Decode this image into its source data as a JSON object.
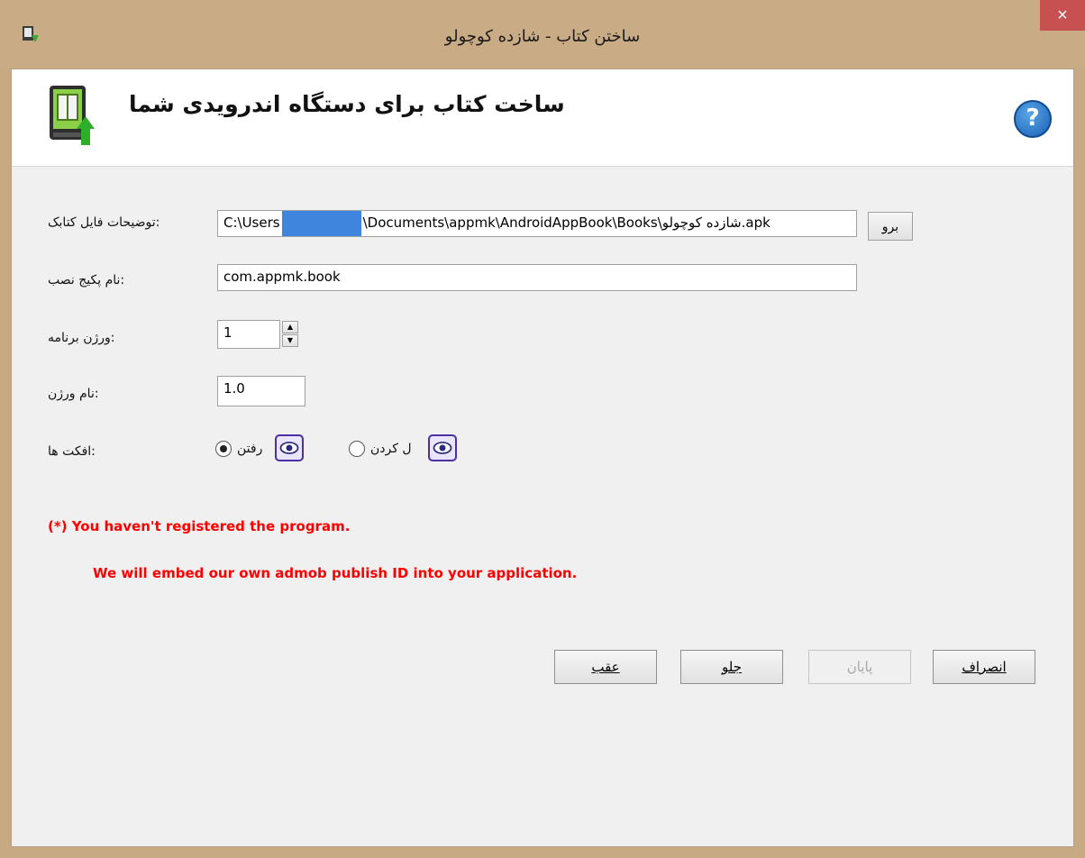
{
  "window": {
    "title": "ساختن کتاب - شازده کوچولو",
    "close_label": "×"
  },
  "header": {
    "title": "ساخت کتاب برای دستگاه اندرویدی شما",
    "help_label": "?"
  },
  "form": {
    "file_label": ":توضیحات فایل کتابک",
    "file_path_prefix": "C:\\Users",
    "file_path_suffix": "\\Documents\\appmk\\AndroidAppBook\\Books\\شازده کوچولو.apk",
    "browse_label": "برو",
    "package_label": ":نام پکیج نصب",
    "package_value": "com.appmk.book",
    "version_label": ":ورژن برنامه",
    "version_value": "1",
    "version_name_label": ":نام ورژن",
    "version_name_value": "1.0",
    "effects_label": ":افکت ها",
    "effect_1_label": "رفتن",
    "effect_1_checked": true,
    "effect_2_label": "ل کردن",
    "effect_2_checked": false
  },
  "warnings": {
    "line1": "(*)   You haven't registered the program.",
    "line2": "We will embed our own admob publish ID into your  application."
  },
  "buttons": {
    "back": "عقب",
    "next": "جلو",
    "finish": "پایان",
    "cancel": "انصراف"
  },
  "colors": {
    "title_bar": "#c9ab86",
    "close_button": "#c75050",
    "warning_text": "#ff0000",
    "redaction": "#3f85dd"
  }
}
